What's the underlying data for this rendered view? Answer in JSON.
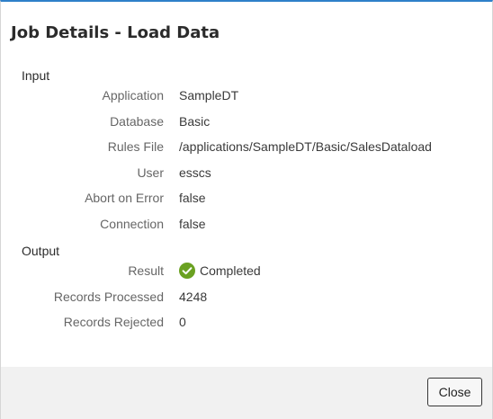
{
  "dialog": {
    "title": "Job Details - Load Data",
    "accent_color": "#2f80c9"
  },
  "input": {
    "heading": "Input",
    "fields": [
      {
        "label": "Application",
        "value": "SampleDT"
      },
      {
        "label": "Database",
        "value": "Basic"
      },
      {
        "label": "Rules File",
        "value": "/applications/SampleDT/Basic/SalesDataload"
      },
      {
        "label": "User",
        "value": "esscs"
      },
      {
        "label": "Abort on Error",
        "value": "false"
      },
      {
        "label": "Connection",
        "value": "false"
      }
    ]
  },
  "output": {
    "heading": "Output",
    "result": {
      "label": "Result",
      "value": "Completed",
      "icon": "check-circle-icon",
      "icon_color": "#6aa121"
    },
    "records_processed": {
      "label": "Records Processed",
      "value": "4248"
    },
    "records_rejected": {
      "label": "Records Rejected",
      "value": "0"
    }
  },
  "footer": {
    "close_label": "Close"
  }
}
